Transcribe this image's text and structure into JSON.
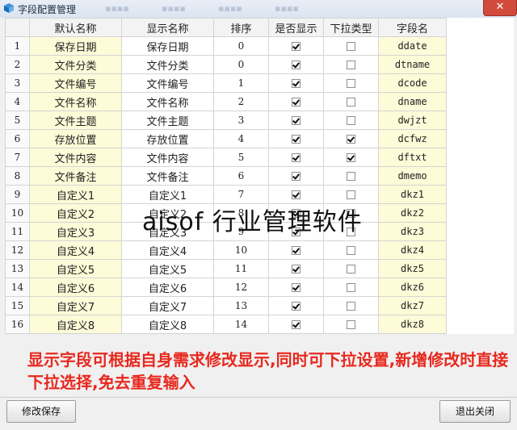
{
  "window": {
    "title": "字段配置管理",
    "close_glyph": "✕"
  },
  "grid": {
    "columns": [
      "",
      "默认名称",
      "显示名称",
      "排序",
      "是否显示",
      "下拉类型",
      "字段名"
    ],
    "rows": [
      {
        "no": "1",
        "default_name": "保存日期",
        "display_name": "保存日期",
        "order": "0",
        "show": true,
        "dropdown": false,
        "field": "ddate"
      },
      {
        "no": "2",
        "default_name": "文件分类",
        "display_name": "文件分类",
        "order": "0",
        "show": true,
        "dropdown": false,
        "field": "dtname"
      },
      {
        "no": "3",
        "default_name": "文件编号",
        "display_name": "文件编号",
        "order": "1",
        "show": true,
        "dropdown": false,
        "field": "dcode"
      },
      {
        "no": "4",
        "default_name": "文件名称",
        "display_name": "文件名称",
        "order": "2",
        "show": true,
        "dropdown": false,
        "field": "dname"
      },
      {
        "no": "5",
        "default_name": "文件主题",
        "display_name": "文件主题",
        "order": "3",
        "show": true,
        "dropdown": false,
        "field": "dwjzt"
      },
      {
        "no": "6",
        "default_name": "存放位置",
        "display_name": "存放位置",
        "order": "4",
        "show": true,
        "dropdown": true,
        "field": "dcfwz"
      },
      {
        "no": "7",
        "default_name": "文件内容",
        "display_name": "文件内容",
        "order": "5",
        "show": true,
        "dropdown": true,
        "field": "dftxt"
      },
      {
        "no": "8",
        "default_name": "文件备注",
        "display_name": "文件备注",
        "order": "6",
        "show": true,
        "dropdown": false,
        "field": "dmemo"
      },
      {
        "no": "9",
        "default_name": "自定义1",
        "display_name": "自定义1",
        "order": "7",
        "show": true,
        "dropdown": false,
        "field": "dkz1"
      },
      {
        "no": "10",
        "default_name": "自定义2",
        "display_name": "自定义2",
        "order": "8",
        "show": true,
        "dropdown": false,
        "field": "dkz2"
      },
      {
        "no": "11",
        "default_name": "自定义3",
        "display_name": "自定义3",
        "order": "9",
        "show": true,
        "dropdown": false,
        "field": "dkz3"
      },
      {
        "no": "12",
        "default_name": "自定义4",
        "display_name": "自定义4",
        "order": "10",
        "show": true,
        "dropdown": false,
        "field": "dkz4"
      },
      {
        "no": "13",
        "default_name": "自定义5",
        "display_name": "自定义5",
        "order": "11",
        "show": true,
        "dropdown": false,
        "field": "dkz5"
      },
      {
        "no": "14",
        "default_name": "自定义6",
        "display_name": "自定义6",
        "order": "12",
        "show": true,
        "dropdown": false,
        "field": "dkz6"
      },
      {
        "no": "15",
        "default_name": "自定义7",
        "display_name": "自定义7",
        "order": "13",
        "show": true,
        "dropdown": false,
        "field": "dkz7"
      },
      {
        "no": "16",
        "default_name": "自定义8",
        "display_name": "自定义8",
        "order": "14",
        "show": true,
        "dropdown": false,
        "field": "dkz8"
      }
    ]
  },
  "watermark": "aisof 行业管理软件",
  "note": "显示字段可根据自身需求修改显示,同时可下拉设置,新增修改时直接下拉选择,免去重复输入",
  "buttons": {
    "save": "修改保存",
    "exit": "退出关闭"
  },
  "colors": {
    "note_text": "#e8281e",
    "highlight_cell": "#fdfbd8",
    "close_button": "#d24a3c"
  }
}
